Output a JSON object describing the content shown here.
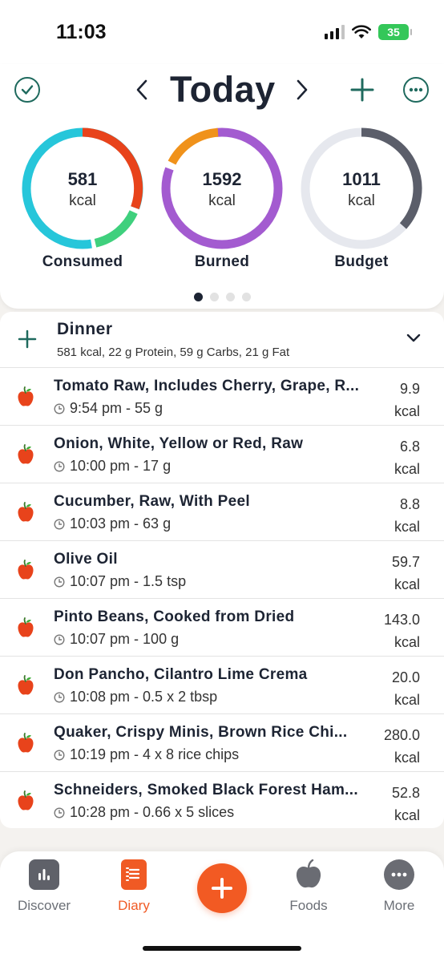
{
  "status_bar": {
    "time": "11:03",
    "battery": "35"
  },
  "header": {
    "title": "Today",
    "check_icon": "check-circle-icon",
    "prev_icon": "chevron-left-icon",
    "next_icon": "chevron-right-icon",
    "add_icon": "plus-icon",
    "more_icon": "more-horizontal-icon"
  },
  "rings": [
    {
      "value": "581",
      "unit": "kcal",
      "label": "Consumed"
    },
    {
      "value": "1592",
      "unit": "kcal",
      "label": "Burned"
    },
    {
      "value": "1011",
      "unit": "kcal",
      "label": "Budget"
    }
  ],
  "page_dots": {
    "count": 4,
    "active": 0
  },
  "meal": {
    "title": "Dinner",
    "summary": "581 kcal, 22 g Protein, 59 g Carbs, 21 g Fat",
    "items": [
      {
        "name": "Tomato Raw, Includes Cherry, Grape, R...",
        "time": "9:54 pm - 55 g",
        "value": "9.9",
        "unit": "kcal"
      },
      {
        "name": "Onion, White, Yellow or Red, Raw",
        "time": "10:00 pm - 17 g",
        "value": "6.8",
        "unit": "kcal"
      },
      {
        "name": "Cucumber, Raw, With Peel",
        "time": "10:03 pm - 63 g",
        "value": "8.8",
        "unit": "kcal"
      },
      {
        "name": "Olive Oil",
        "time": "10:07 pm - 1.5 tsp",
        "value": "59.7",
        "unit": "kcal"
      },
      {
        "name": "Pinto Beans, Cooked from Dried",
        "time": "10:07 pm - 100 g",
        "value": "143.0",
        "unit": "kcal"
      },
      {
        "name": "Don Pancho, Cilantro Lime Crema",
        "time": "10:08 pm - 0.5 x 2  tbsp",
        "value": "20.0",
        "unit": "kcal"
      },
      {
        "name": "Quaker, Crispy Minis, Brown Rice Chi...",
        "time": "10:19 pm - 4 x 8 rice chips",
        "value": "280.0",
        "unit": "kcal"
      },
      {
        "name": "Schneiders, Smoked Black Forest Ham...",
        "time": "10:28 pm - 0.66 x 5 slices",
        "value": "52.8",
        "unit": "kcal"
      }
    ]
  },
  "tabs": [
    {
      "label": "Discover",
      "icon": "bar-chart-icon"
    },
    {
      "label": "Diary",
      "icon": "notebook-icon",
      "active": true
    },
    {
      "label": "Foods",
      "icon": "apple-icon"
    },
    {
      "label": "More",
      "icon": "more-horizontal-icon"
    }
  ],
  "colors": {
    "accent": "#1f6a5e",
    "orange": "#f25a23",
    "consumed_cyan": "#26c6da",
    "consumed_red": "#e8431b",
    "consumed_green": "#3fd07d",
    "burned_purple": "#a35bd0",
    "burned_orange": "#f0921b",
    "budget_gray": "#5b5e6a",
    "ring_track": "#e6e8ee"
  }
}
